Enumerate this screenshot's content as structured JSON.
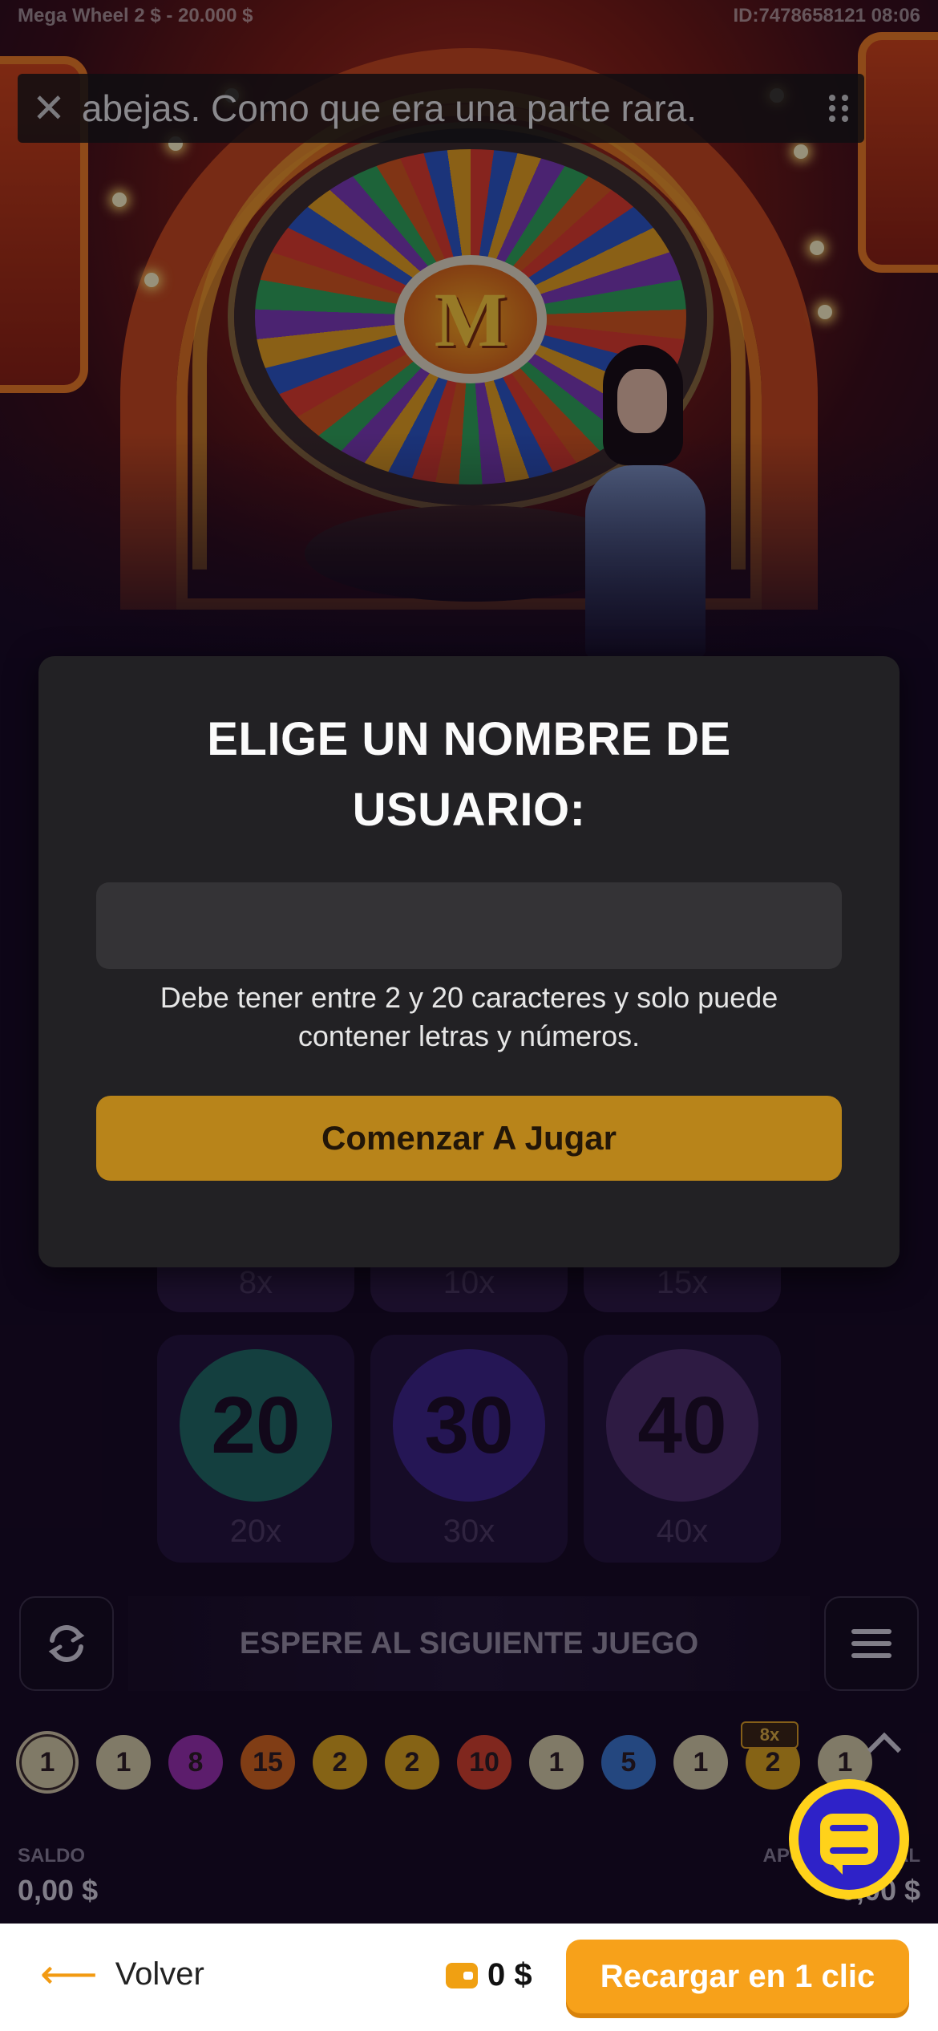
{
  "stream": {
    "game_info": "Mega Wheel   2 $ - 20.000 $",
    "session_info": "ID:7478658121   08:06",
    "wheel_logo": "M",
    "caption_text": "abejas. Como que era una parte rara."
  },
  "modal": {
    "title_line1": "ELIGE UN NOMBRE DE",
    "title_line2": "USUARIO:",
    "input_value": "",
    "hint": "Debe tener entre 2 y 20 caracteres y solo puede contener letras y números.",
    "start_button": "Comenzar A Jugar"
  },
  "betting": {
    "top_row_multipliers": [
      "8x",
      "10x",
      "15x"
    ],
    "cells": [
      {
        "number": "20",
        "multiplier": "20x",
        "color": "#1e6a62"
      },
      {
        "number": "30",
        "multiplier": "30x",
        "color": "#3c2488"
      },
      {
        "number": "40",
        "multiplier": "40x",
        "color": "#4a2c6a"
      }
    ]
  },
  "status": {
    "wait_text": "ESPERE AL SIGUIENTE JUEGO"
  },
  "history": {
    "results": [
      {
        "value": "1",
        "color": "#d8cfa8"
      },
      {
        "value": "1",
        "color": "#d8cfa8"
      },
      {
        "value": "8",
        "color": "#9a2fb0"
      },
      {
        "value": "15",
        "color": "#d8661a"
      },
      {
        "value": "2",
        "color": "#e0a81a"
      },
      {
        "value": "2",
        "color": "#e0a81a"
      },
      {
        "value": "10",
        "color": "#d8402a"
      },
      {
        "value": "1",
        "color": "#d8cfa8"
      },
      {
        "value": "5",
        "color": "#3a78d0"
      },
      {
        "value": "1",
        "color": "#d8cfa8"
      },
      {
        "value": "2",
        "color": "#e0a81a"
      },
      {
        "value": "1",
        "color": "#d8cfa8"
      }
    ],
    "boost_badge": "8x"
  },
  "balance": {
    "saldo_label": "SALDO",
    "saldo_value": "0,00 $",
    "apuesta_label": "APUESTA TOTAL",
    "apuesta_value": "0,00 $"
  },
  "bottom_bar": {
    "back_label": "Volver",
    "wallet_amount": "0 $",
    "recharge_label": "Recargar en 1 clic"
  },
  "colors": {
    "accent": "#f7a11a",
    "modal_button": "#b8841a",
    "chat_bubble": "#2e22c8"
  }
}
